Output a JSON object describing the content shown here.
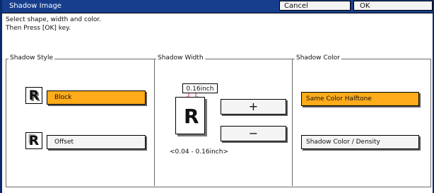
{
  "window": {
    "title": "Shadow Image",
    "cancel_label": "Cancel",
    "ok_label": "OK"
  },
  "instructions": {
    "line1": "Select shape, width and color.",
    "line2": "Then Press [OK] key."
  },
  "shadow_style": {
    "title": "Shadow Style",
    "items": [
      {
        "icon_letter": "R",
        "label": "Block",
        "selected": true
      },
      {
        "icon_letter": "R",
        "label": "Offset",
        "selected": false
      }
    ]
  },
  "shadow_width": {
    "title": "Shadow Width",
    "value": "0.16inch",
    "preview_letter": "R",
    "plus_label": "+",
    "minus_label": "−",
    "range": "<0.04 - 0.16inch>"
  },
  "shadow_color": {
    "title": "Shadow Color",
    "items": [
      {
        "label": "Same Color Halftone",
        "selected": true
      },
      {
        "label": "Shadow Color / Density",
        "selected": false
      }
    ]
  },
  "colors": {
    "title_bar": "#163e8c",
    "selected_button": "#ffab1a",
    "button": "#f4f4f4",
    "frame": "#0b2a6b",
    "marker": "#e0105c"
  }
}
